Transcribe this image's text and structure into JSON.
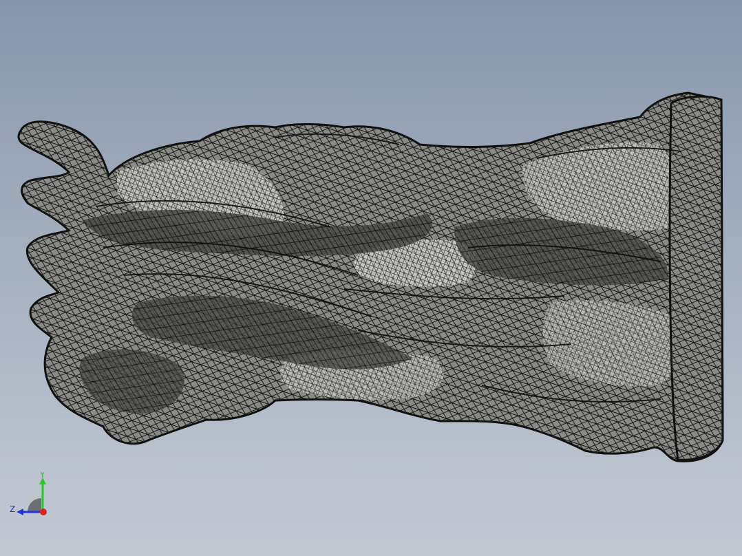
{
  "viewport": {
    "background_top": "#8796ab",
    "background_bottom": "#c3c9d3"
  },
  "model": {
    "render_mode": "shaded-with-edges",
    "fill_color": "#6e6e6e",
    "edge_color": "#111111",
    "highlight_color": "#e8e8e2"
  },
  "triad": {
    "y_label": "Y",
    "z_label": "Z",
    "y_color": "#22cc22",
    "z_color": "#2233dd",
    "x_color": "#dd2222"
  }
}
